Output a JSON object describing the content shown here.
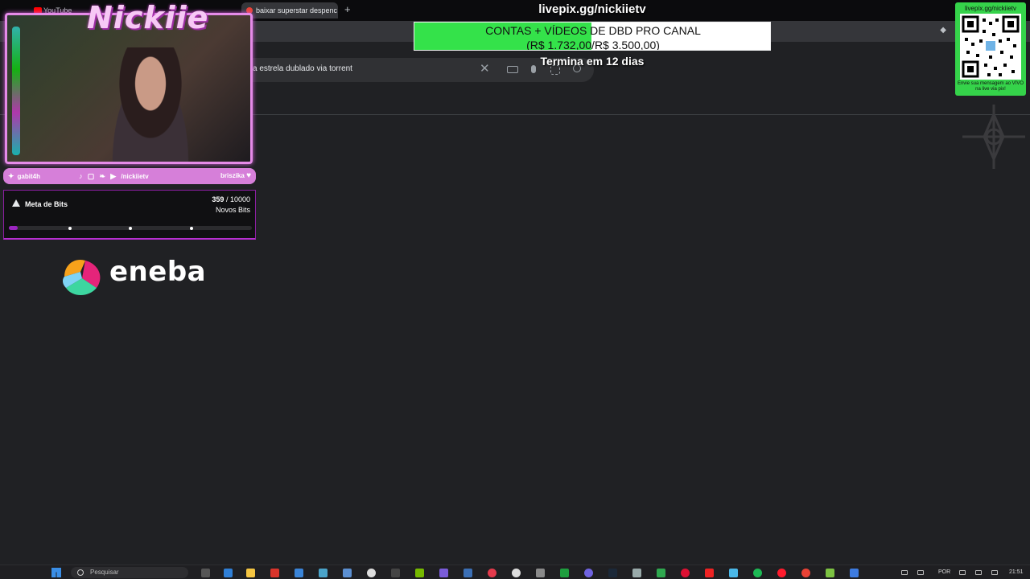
{
  "browser": {
    "tabs": [
      {
        "label": "YouTube"
      },
      {
        "label": "baixar superstar despenc"
      }
    ],
    "new_tab_symbol": "+",
    "search_query": "a estrela dublado via torrent"
  },
  "overlay": {
    "brand_logo_text": "Nickiie",
    "socials": {
      "left_handle": "gabit4h",
      "middle_handle": "/nickiietv",
      "right_handle": "briszika"
    },
    "bits_goal": {
      "title": "Meta de Bits",
      "current": "359",
      "separator": " / ",
      "target": "10000",
      "subtitle": "Novos Bits",
      "progress": 0.036,
      "checkpoints": [
        0.25,
        0.5,
        0.75
      ]
    },
    "sponsor_name": "eneba",
    "pix": {
      "url": "livepix.gg/nickiietv",
      "goal_title": "CONTAS + VÍDEOS DE DBD PRO CANAL",
      "goal_amount": "(R$ 1.732,00/R$ 3.500,00)",
      "goal_progress": 0.495,
      "ends_text": "Termina em 12 dias"
    },
    "qr_panel": {
      "url": "livepix.gg/nickiietv",
      "message": "Envie sua mensagem ao VIVO na live via pix!"
    }
  },
  "taskbar": {
    "search_placeholder": "Pesquisar",
    "language": "POR",
    "time": "21:51"
  },
  "colors": {
    "overlay_pink": "#e58be8",
    "bits_purple": "#9b25c0",
    "pix_green": "#34e24a"
  }
}
